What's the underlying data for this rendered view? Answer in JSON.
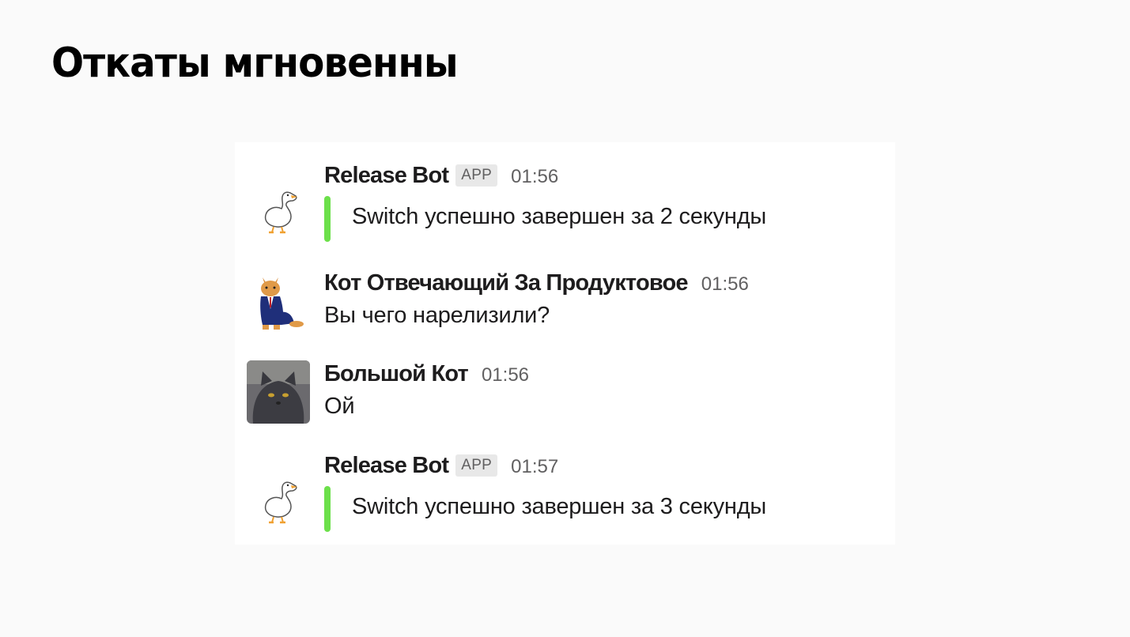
{
  "slide": {
    "title": "Откаты мгновенны"
  },
  "colors": {
    "background": "#fafafa",
    "panel": "#ffffff",
    "text": "#1d1c1d",
    "muted": "#616061",
    "badge_bg": "#e8e8e8",
    "attachment_bar": "#6ce04a"
  },
  "messages": [
    {
      "author": "Release Bot",
      "badge": "APP",
      "time": "01:56",
      "avatar_icon": "goose-avatar-icon",
      "attachment_text": "Switch успешно завершен за 2 секунды"
    },
    {
      "author": "Кот Отвечающий За Продуктовое",
      "time": "01:56",
      "avatar_icon": "cat-in-suit-avatar-icon",
      "text": "Вы чего нарелизили?"
    },
    {
      "author": "Большой Кот",
      "time": "01:56",
      "avatar_icon": "grey-cat-avatar-icon",
      "text": "Ой"
    },
    {
      "author": "Release Bot",
      "badge": "APP",
      "time": "01:57",
      "avatar_icon": "goose-avatar-icon",
      "attachment_text": "Switch успешно завершен за 3 секунды"
    }
  ]
}
